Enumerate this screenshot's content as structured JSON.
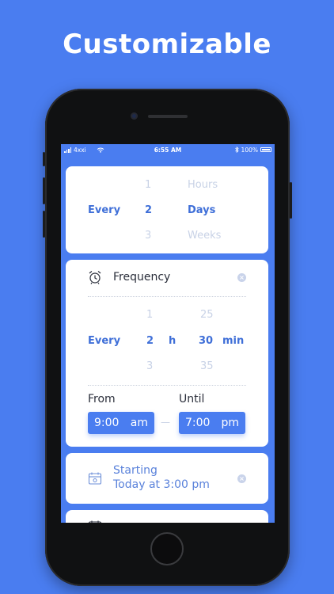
{
  "headline": "Customizable",
  "status": {
    "carrier": "4xxi",
    "time": "6:55 AM",
    "battery": "100%"
  },
  "interval_picker": {
    "label": "Every",
    "numbers": [
      "1",
      "2",
      "3"
    ],
    "units": [
      "Hours",
      "Days",
      "Weeks"
    ]
  },
  "frequency": {
    "title": "Frequency",
    "every": "Every",
    "hours": [
      "1",
      "2",
      "3"
    ],
    "hour_unit": "h",
    "minutes": [
      "25",
      "30",
      "35"
    ],
    "min_unit": "min",
    "from_label": "From",
    "until_label": "Until",
    "from": {
      "time": "9:00",
      "ampm": "am"
    },
    "until": {
      "time": "7:00",
      "ampm": "pm"
    },
    "dash": "—"
  },
  "starting": {
    "label": "Starting",
    "value": "Today at 3:00 pm"
  },
  "colors": {
    "accent": "#4a7df0",
    "text_blue": "#3f6fd8",
    "muted": "#c8d2e6"
  },
  "icons": [
    "wifi-icon",
    "bluetooth-icon",
    "battery-icon",
    "alarm-clock-icon",
    "clear-icon",
    "calendar-icon"
  ]
}
